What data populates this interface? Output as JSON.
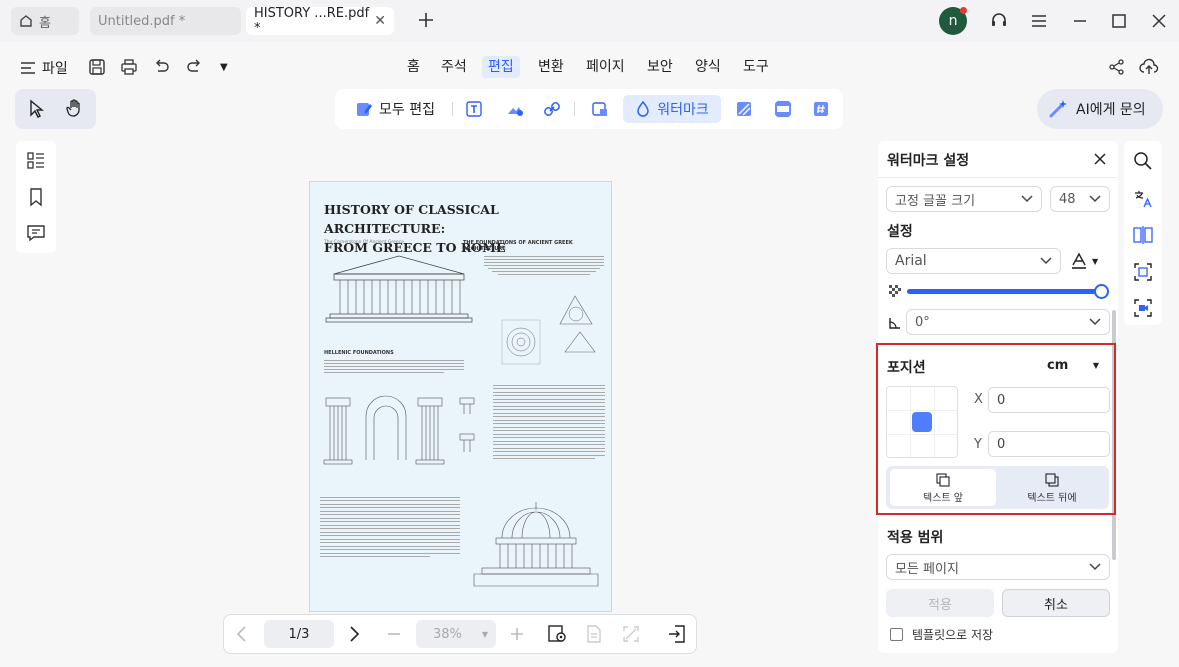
{
  "tabs": {
    "home": "홈",
    "tab2": "Untitled.pdf *",
    "tab3": "HISTORY ...RE.pdf *",
    "avatar": "n"
  },
  "menu": {
    "file": "파일",
    "items": [
      "홈",
      "주석",
      "편집",
      "변환",
      "페이지",
      "보안",
      "양식",
      "도구"
    ],
    "active": "편집"
  },
  "toolbar": {
    "edit_all": "모두 편집",
    "watermark": "워터마크",
    "ai": "AI에게 문의"
  },
  "document": {
    "title_line1": "HISTORY OF CLASSICAL  ARCHITECTURE:",
    "title_line2": "FROM GREECE TO ROME",
    "subtitle": "The Cornerstone Of Ancient Greece",
    "section1": "THE FOUNDATIONS OF ANCIENT GREEK ARCHITECTURE",
    "section2": "HELLENIC FOUNDATIONS"
  },
  "bottom": {
    "page": "1/3",
    "zoom": "38%"
  },
  "panel": {
    "title": "워터마크 설정",
    "font_size_mode": "고정 글꼴 크기",
    "font_size": "48",
    "settings_label": "설정",
    "font": "Arial",
    "opacity_level": 1.0,
    "rotation": "0°",
    "position_label": "포지션",
    "unit": "cm",
    "x_label": "X",
    "x_value": "0",
    "y_label": "Y",
    "y_value": "0",
    "front_label": "텍스트 앞",
    "back_label": "텍스트 뒤에",
    "scope_label": "적용 범위",
    "scope_value": "모든 페이지",
    "apply": "적용",
    "cancel": "취소",
    "save_template": "템플릿으로 저장"
  },
  "colors": {
    "accent": "#2b62ff",
    "highlight_border": "#d42a2a",
    "avatar_bg": "#1f5a3c"
  }
}
